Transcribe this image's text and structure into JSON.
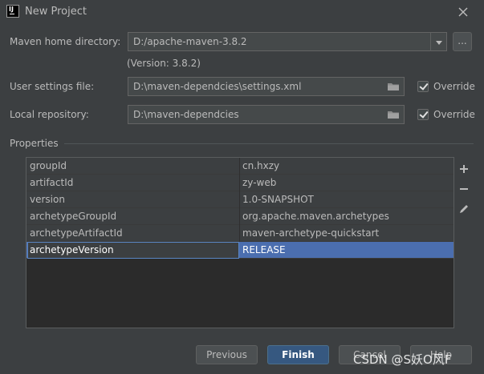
{
  "window": {
    "title": "New Project",
    "app_icon_letters": "IJ"
  },
  "maven": {
    "home_label": "Maven home directory:",
    "home_value": "D:/apache-maven-3.8.2",
    "version_text": "(Version: 3.8.2)",
    "browse_label": "...",
    "user_settings_label": "User settings file:",
    "user_settings_value": "D:\\maven-dependcies\\settings.xml",
    "local_repo_label": "Local repository:",
    "local_repo_value": "D:\\maven-dependcies",
    "override_label": "Override",
    "override_settings_checked": true,
    "override_repo_checked": true
  },
  "properties": {
    "section_title": "Properties",
    "rows": [
      {
        "key": "groupId",
        "value": "cn.hxzy"
      },
      {
        "key": "artifactId",
        "value": "zy-web"
      },
      {
        "key": "version",
        "value": "1.0-SNAPSHOT"
      },
      {
        "key": "archetypeGroupId",
        "value": "org.apache.maven.archetypes"
      },
      {
        "key": "archetypeArtifactId",
        "value": "maven-archetype-quickstart"
      },
      {
        "key": "archetypeVersion",
        "value": "RELEASE",
        "selected": true
      }
    ],
    "tools": [
      "add-icon",
      "remove-icon",
      "edit-icon"
    ]
  },
  "buttons": {
    "previous": "Previous",
    "finish": "Finish",
    "cancel": "Cancel",
    "help": "Help"
  },
  "watermark": "CSDN @S妖O风F",
  "colors": {
    "background": "#3c3f41",
    "field": "#45494a",
    "selection": "#4b6eaf",
    "primary_button": "#365880"
  }
}
